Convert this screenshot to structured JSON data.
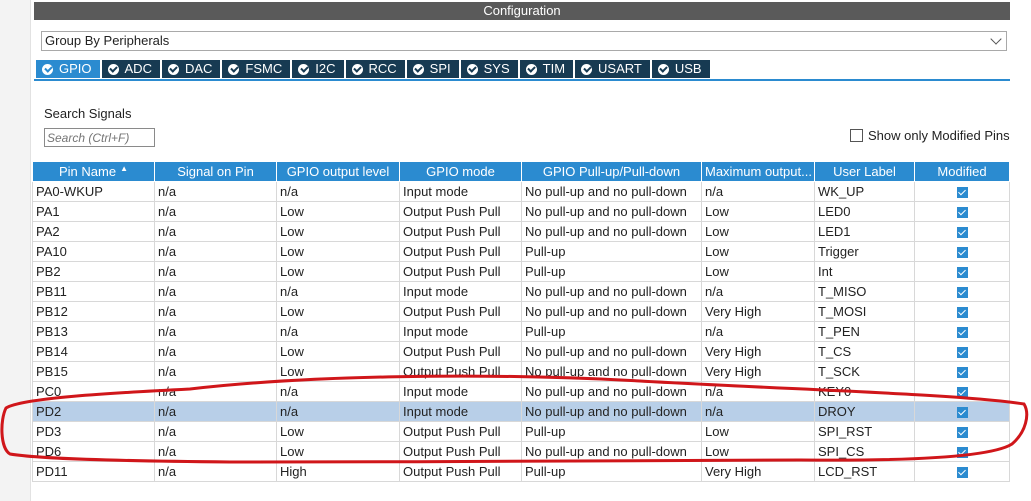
{
  "window": {
    "title": "Configuration"
  },
  "group_select": {
    "value": "Group By Peripherals"
  },
  "tabs": [
    {
      "label": "GPIO"
    },
    {
      "label": "ADC"
    },
    {
      "label": "DAC"
    },
    {
      "label": "FSMC"
    },
    {
      "label": "I2C"
    },
    {
      "label": "RCC"
    },
    {
      "label": "SPI"
    },
    {
      "label": "SYS"
    },
    {
      "label": "TIM"
    },
    {
      "label": "USART"
    },
    {
      "label": "USB"
    }
  ],
  "search": {
    "label": "Search Signals",
    "placeholder": "Search (Ctrl+F)"
  },
  "modified_toggle": {
    "label": "Show only Modified Pins"
  },
  "table": {
    "headers": [
      "Pin Name",
      "Signal on Pin",
      "GPIO output level",
      "GPIO mode",
      "GPIO Pull-up/Pull-down",
      "Maximum output...",
      "User Label",
      "Modified"
    ],
    "selected_row": 11,
    "rows": [
      [
        "PA0-WKUP",
        "n/a",
        "n/a",
        "Input mode",
        "No pull-up and no pull-down",
        "n/a",
        "WK_UP",
        true
      ],
      [
        "PA1",
        "n/a",
        "Low",
        "Output Push Pull",
        "No pull-up and no pull-down",
        "Low",
        "LED0",
        true
      ],
      [
        "PA2",
        "n/a",
        "Low",
        "Output Push Pull",
        "No pull-up and no pull-down",
        "Low",
        "LED1",
        true
      ],
      [
        "PA10",
        "n/a",
        "Low",
        "Output Push Pull",
        "Pull-up",
        "Low",
        "Trigger",
        true
      ],
      [
        "PB2",
        "n/a",
        "Low",
        "Output Push Pull",
        "Pull-up",
        "Low",
        "Int",
        true
      ],
      [
        "PB11",
        "n/a",
        "n/a",
        "Input mode",
        "No pull-up and no pull-down",
        "n/a",
        "T_MISO",
        true
      ],
      [
        "PB12",
        "n/a",
        "Low",
        "Output Push Pull",
        "No pull-up and no pull-down",
        "Very High",
        "T_MOSI",
        true
      ],
      [
        "PB13",
        "n/a",
        "n/a",
        "Input mode",
        "Pull-up",
        "n/a",
        "T_PEN",
        true
      ],
      [
        "PB14",
        "n/a",
        "Low",
        "Output Push Pull",
        "No pull-up and no pull-down",
        "Very High",
        "T_CS",
        true
      ],
      [
        "PB15",
        "n/a",
        "Low",
        "Output Push Pull",
        "No pull-up and no pull-down",
        "Very High",
        "T_SCK",
        true
      ],
      [
        "PC0",
        "n/a",
        "n/a",
        "Input mode",
        "No pull-up and no pull-down",
        "n/a",
        "KEY0",
        true
      ],
      [
        "PD2",
        "n/a",
        "n/a",
        "Input mode",
        "No pull-up and no pull-down",
        "n/a",
        "DROY",
        true
      ],
      [
        "PD3",
        "n/a",
        "Low",
        "Output Push Pull",
        "Pull-up",
        "Low",
        "SPI_RST",
        true
      ],
      [
        "PD6",
        "n/a",
        "Low",
        "Output Push Pull",
        "No pull-up and no pull-down",
        "Low",
        "SPI_CS",
        true
      ],
      [
        "PD11",
        "n/a",
        "High",
        "Output Push Pull",
        "Pull-up",
        "Very High",
        "LCD_RST",
        true
      ]
    ]
  },
  "colors": {
    "accent": "#2b8bd0",
    "tab_dark": "#173a52",
    "selection": "#b8cfe8",
    "annotation": "#d0161a"
  }
}
